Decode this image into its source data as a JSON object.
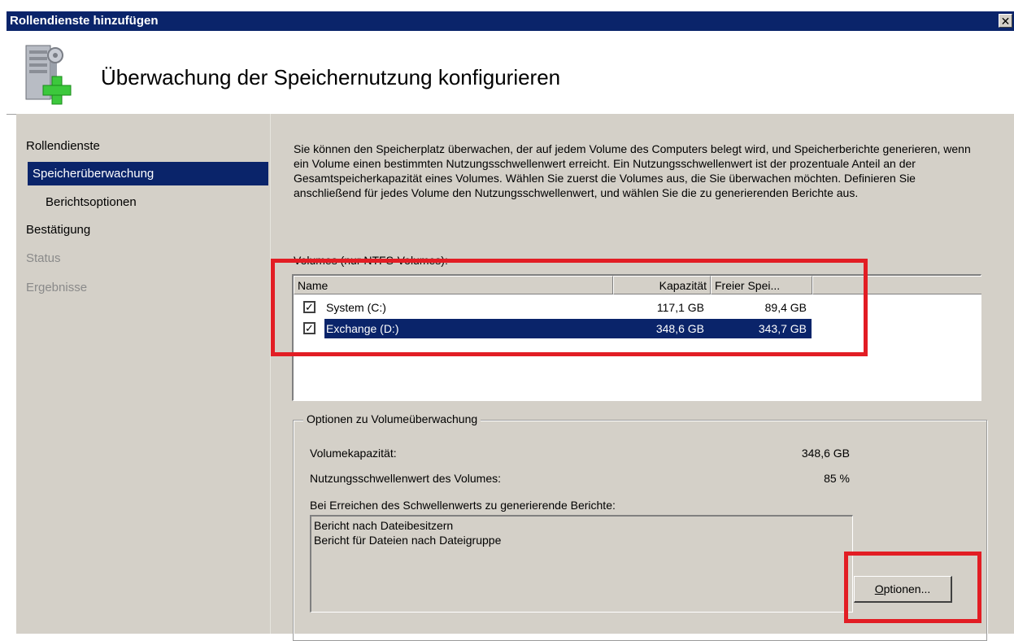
{
  "window": {
    "title": "Rollendienste hinzufügen",
    "close_glyph": "✕"
  },
  "header": {
    "title": "Überwachung der Speichernutzung konfigurieren",
    "icon": "server-add-icon"
  },
  "sidebar": {
    "items": [
      {
        "label": "Rollendienste",
        "state": "normal"
      },
      {
        "label": "Speicherüberwachung",
        "state": "active"
      },
      {
        "label": "Berichtsoptionen",
        "state": "sub"
      },
      {
        "label": "Bestätigung",
        "state": "normal"
      },
      {
        "label": "Status",
        "state": "disabled"
      },
      {
        "label": "Ergebnisse",
        "state": "disabled"
      }
    ]
  },
  "main": {
    "description": "Sie können den Speicherplatz überwachen, der auf jedem Volume des Computers belegt wird, und Speicherberichte generieren, wenn ein Volume einen bestimmten Nutzungsschwellenwert erreicht. Ein Nutzungsschwellenwert ist der prozentuale Anteil an der Gesamtspeicherkapazität eines Volumes. Wählen Sie zuerst die Volumes aus, die Sie überwachen möchten. Definieren Sie anschließend für jedes Volume den Nutzungsschwellenwert, und wählen Sie die zu generierenden Berichte aus.",
    "volumes_label": "Volumes (nur NTFS-Volumes):",
    "columns": [
      "Name",
      "Kapazität",
      "Freier Spei..."
    ],
    "volumes": [
      {
        "name": "System (C:)",
        "capacity": "117,1 GB",
        "free": "89,4 GB",
        "checked": true,
        "selected": false
      },
      {
        "name": "Exchange (D:)",
        "capacity": "348,6 GB",
        "free": "343,7 GB",
        "checked": true,
        "selected": true
      }
    ],
    "options_group": {
      "title": "Optionen zu Volumeüberwachung",
      "capacity_label": "Volumekapazität:",
      "capacity_value": "348,6 GB",
      "threshold_label": "Nutzungsschwellenwert des Volumes:",
      "threshold_value": "85 %",
      "reports_label": "Bei Erreichen des Schwellenwerts zu generierende Berichte:",
      "reports": [
        "Bericht nach Dateibesitzern",
        "Bericht für Dateien nach Dateigruppe"
      ],
      "options_button_mnemonic": "O",
      "options_button_rest": "ptionen..."
    }
  },
  "colors": {
    "highlight": "#0a246a",
    "dialog_bg": "#d4d0c8",
    "annotation_red": "#e21d24"
  }
}
